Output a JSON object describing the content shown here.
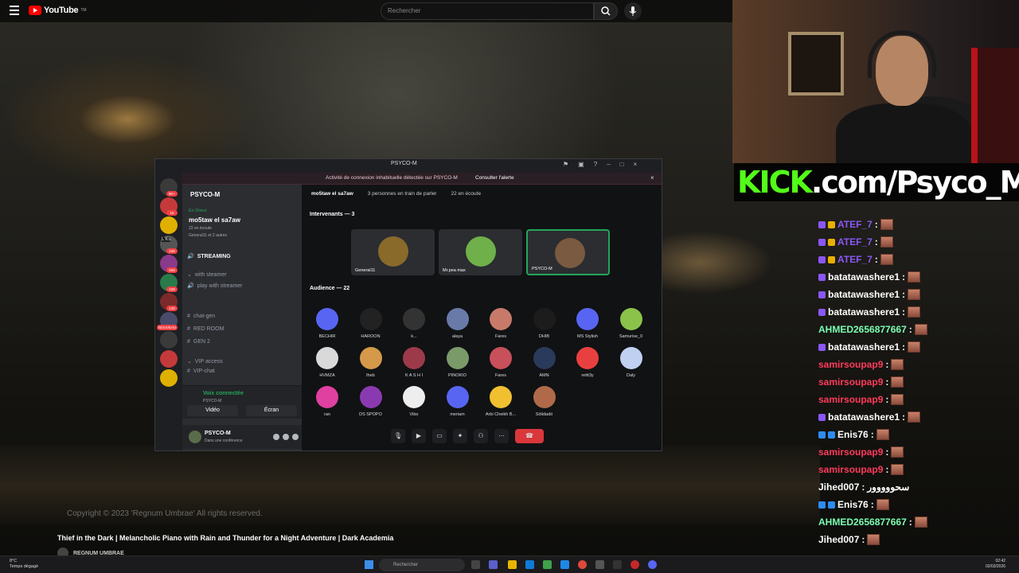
{
  "youtube": {
    "logo": "YouTube",
    "logo_sup": "TM",
    "search_placeholder": "Rechercher",
    "copyright": "Copyright © 2023 'Regnum Umbrae' All rights reserved.",
    "video_title": "Thief in the Dark | Melancholic Piano with Rain and Thunder for a Night Adventure | Dark Academia",
    "channel": "REGNUM UMBRAE"
  },
  "kick": {
    "k": "KICK",
    "rest": ".com/Psyco_M",
    "brand_color": "#53fc18"
  },
  "chat": [
    {
      "user": "ATEF_7",
      "color": "#8a57f6",
      "badges": [
        "b1",
        "b2"
      ]
    },
    {
      "user": "ATEF_7",
      "color": "#8a57f6",
      "badges": [
        "b1",
        "b2"
      ]
    },
    {
      "user": "ATEF_7",
      "color": "#8a57f6",
      "badges": [
        "b1",
        "b2"
      ]
    },
    {
      "user": "batatawashere1",
      "color": "#ffffff",
      "badges": [
        "b1"
      ]
    },
    {
      "user": "batatawashere1",
      "color": "#ffffff",
      "badges": [
        "b1"
      ]
    },
    {
      "user": "batatawashere1",
      "color": "#ffffff",
      "badges": [
        "b1"
      ]
    },
    {
      "user": "AHMED2656877667",
      "color": "#7cffb2",
      "badges": []
    },
    {
      "user": "batatawashere1",
      "color": "#ffffff",
      "badges": [
        "b1"
      ]
    },
    {
      "user": "samirsoupap9",
      "color": "#ff3b5c",
      "badges": []
    },
    {
      "user": "samirsoupap9",
      "color": "#ff3b5c",
      "badges": []
    },
    {
      "user": "samirsoupap9",
      "color": "#ff3b5c",
      "badges": []
    },
    {
      "user": "batatawashere1",
      "color": "#ffffff",
      "badges": [
        "b1"
      ]
    },
    {
      "user": "Enis76",
      "color": "#ffffff",
      "badges": [
        "b3",
        "b3"
      ]
    },
    {
      "user": "samirsoupap9",
      "color": "#ff3b5c",
      "badges": []
    },
    {
      "user": "samirsoupap9",
      "color": "#ff3b5c",
      "badges": []
    },
    {
      "user": "Jihed007",
      "color": "#ffffff",
      "badges": [],
      "text": "سحووووور"
    },
    {
      "user": "Enis76",
      "color": "#ffffff",
      "badges": [
        "b3",
        "b3"
      ]
    },
    {
      "user": "AHMED2656877667",
      "color": "#7cffb2",
      "badges": []
    },
    {
      "user": "Jihed007",
      "color": "#ffffff",
      "badges": []
    }
  ],
  "discord": {
    "window_title": "PSYCO-M",
    "alert_text": "Activité de connexion inhabituelle détectée sur PSYCO-M",
    "alert_link": "Consulter l'alerte",
    "guild_name": "PSYCO-M",
    "live_label": "En Direct",
    "event_title": "mo5taw el sa7aw",
    "event_sub": "22 en écoute",
    "event_sub2": "General11 et 2 autres",
    "channels": [
      {
        "name": "STREAMING",
        "kind": "voice"
      },
      {
        "name": "with steamer",
        "kind": "category"
      },
      {
        "name": "play with streamer",
        "kind": "voice"
      },
      {
        "name": "chat-gen",
        "kind": "text"
      },
      {
        "name": "RED ROOM",
        "kind": "text"
      },
      {
        "name": "GEN 2",
        "kind": "text"
      },
      {
        "name": "VIP access",
        "kind": "category"
      },
      {
        "name": "VIP-chat",
        "kind": "text"
      }
    ],
    "server_badges": [
      "9K+",
      "16",
      "248",
      "608",
      "109",
      "139",
      "NOUVEAU"
    ],
    "server_label": "L'Ks",
    "voice_connected": "Voix connectée",
    "voice_channel": "PSYCO-M",
    "video_btn": "Vidéo",
    "screen_btn": "Écran",
    "user_name": "PSYCO-M",
    "user_status": "Dans une conférence",
    "stage_title": "mo5taw el sa7aw",
    "speaking": "3 personnes en train de parler",
    "listening": "22 en écoute",
    "speakers_header": "Intervenants — 3",
    "speakers": [
      {
        "name": "General11",
        "color": "#8a6a2a"
      },
      {
        "name": "Mr.pea max",
        "color": "#6fb04a"
      },
      {
        "name": "PSYCO-M",
        "color": "#7a5a40"
      }
    ],
    "audience_header": "Audience — 22",
    "audience": [
      {
        "name": "BECHIR",
        "color": "#5865f2"
      },
      {
        "name": "HAROON",
        "color": "#222222"
      },
      {
        "name": "k...",
        "color": "#333333"
      },
      {
        "name": "alaya",
        "color": "#6a7aa8"
      },
      {
        "name": "Fares",
        "color": "#c77a6a"
      },
      {
        "name": "DHIB",
        "color": "#1c1c1c"
      },
      {
        "name": "MS Stylish",
        "color": "#5865f2"
      },
      {
        "name": "Samurise_0",
        "color": "#8bc34a"
      },
      {
        "name": "HVMZA",
        "color": "#d9d9d9"
      },
      {
        "name": "lheb",
        "color": "#d49a4a"
      },
      {
        "name": "K A S H I",
        "color": "#9c3a4a"
      },
      {
        "name": "PINOKIO",
        "color": "#7a9a6a"
      },
      {
        "name": "Fares",
        "color": "#c7505a"
      },
      {
        "name": "AMN",
        "color": "#2a3a5a"
      },
      {
        "name": "rettt3y",
        "color": "#e84040"
      },
      {
        "name": "Daly",
        "color": "#c0d0f0"
      },
      {
        "name": "ran",
        "color": "#e040a0"
      },
      {
        "name": "DS SPOPO",
        "color": "#8a3ab0"
      },
      {
        "name": "Vibo",
        "color": "#eeeeee"
      },
      {
        "name": "meriam",
        "color": "#5865f2"
      },
      {
        "name": "Arbi Cheikh B...",
        "color": "#f0c030"
      },
      {
        "name": "Sölidadö",
        "color": "#b06a4a"
      }
    ]
  },
  "taskbar": {
    "temp": "8°C",
    "weather": "Temps dégagé",
    "search": "Rechercher",
    "time": "02:42",
    "date": "02/03/2026"
  }
}
